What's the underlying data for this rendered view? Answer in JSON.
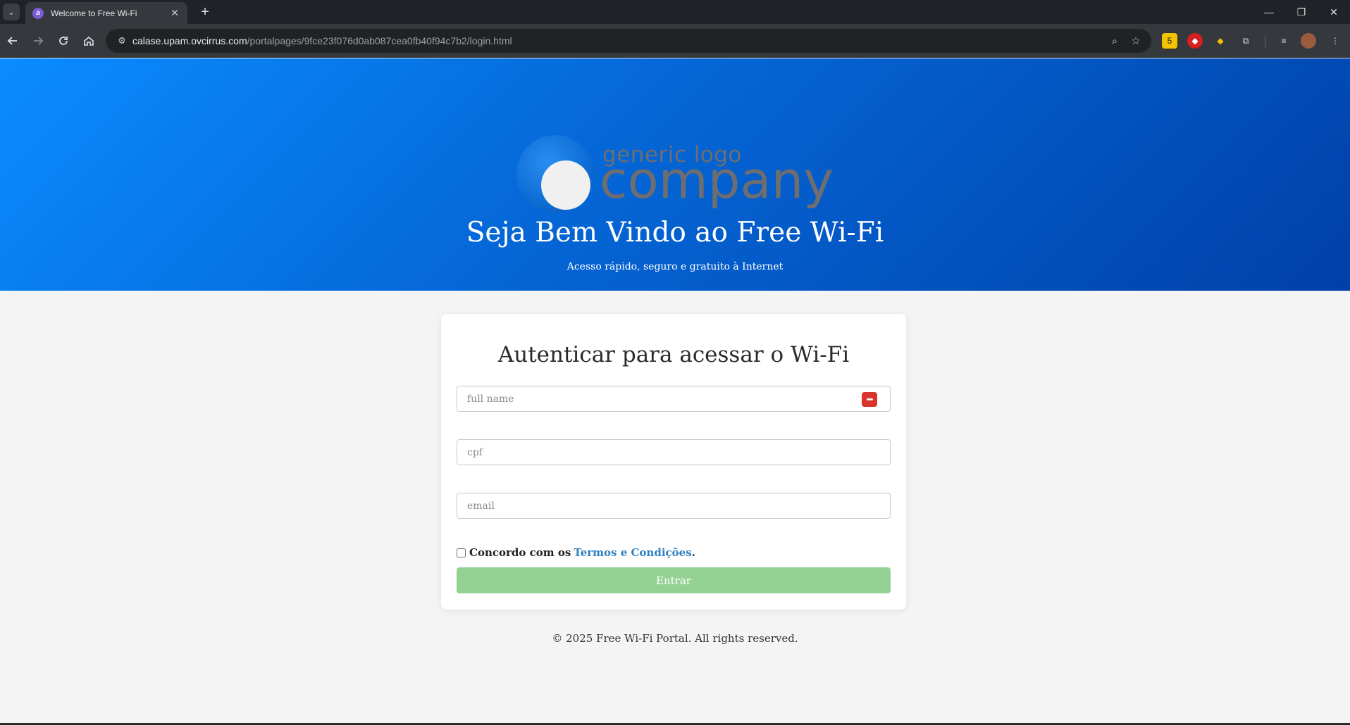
{
  "browser": {
    "tab_title": "Welcome to Free Wi-Fi",
    "tab_close": "✕",
    "new_tab": "+",
    "url_host": "calase.upam.ovcirrus.com",
    "url_path": "/portalpages/9fce23f076d0ab087cea0fb40f94c7b2/login.html",
    "window_controls": {
      "minimize": "—",
      "restore": "❐",
      "close": "✕"
    },
    "extension_badge": "5"
  },
  "hero": {
    "logo_small": "generic logo",
    "logo_big": "company",
    "title": "Seja Bem Vindo ao Free Wi-Fi",
    "subtitle": "Acesso rápido, seguro e gratuito à Internet"
  },
  "form": {
    "title": "Autenticar para acessar o Wi-Fi",
    "full_name_placeholder": "full name",
    "cpf_placeholder": "cpf",
    "email_placeholder": "email",
    "terms_prefix": "Concordo com os",
    "terms_link": "Termos e Condições",
    "terms_suffix": ".",
    "submit_label": "Entrar",
    "password_manager_badge": "•••"
  },
  "footer": {
    "text": "© 2025 Free Wi-Fi Portal. All rights reserved."
  },
  "colors": {
    "hero_gradient_start": "#0a8cff",
    "hero_gradient_end": "#0040a8",
    "submit_button": "#94d294",
    "terms_link": "#2f7fc1"
  }
}
